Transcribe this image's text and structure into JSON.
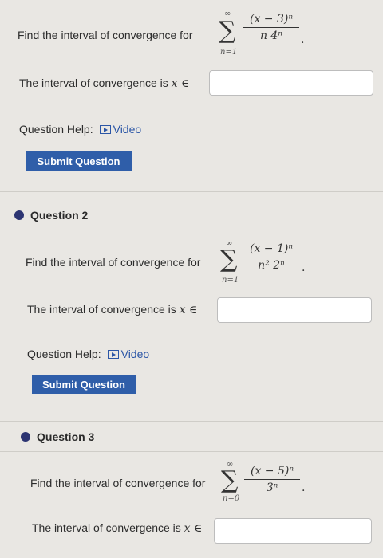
{
  "question1": {
    "prompt": "Find the interval of convergence for",
    "sum_top": "∞",
    "sum_bottom": "n=1",
    "numerator": "(x − 3)ⁿ",
    "denominator": "n 4ⁿ",
    "answer_label_prefix": "The interval of convergence is",
    "answer_var": "x ∈",
    "answer_value": "",
    "help_label": "Question Help:",
    "video_label": "Video",
    "submit_label": "Submit Question"
  },
  "question2": {
    "header": "Question 2",
    "prompt": "Find the interval of convergence for",
    "sum_top": "∞",
    "sum_bottom": "n=1",
    "numerator": "(x − 1)ⁿ",
    "denominator": "n² 2ⁿ",
    "answer_label_prefix": "The interval of convergence is",
    "answer_var": "x ∈",
    "answer_value": "",
    "help_label": "Question Help:",
    "video_label": "Video",
    "submit_label": "Submit Question"
  },
  "question3": {
    "header": "Question 3",
    "prompt": "Find the interval of convergence for",
    "sum_top": "∞",
    "sum_bottom": "n=0",
    "numerator": "(x − 5)ⁿ",
    "denominator": "3ⁿ",
    "answer_label_prefix": "The interval of convergence is",
    "answer_var": "x ∈",
    "answer_value": ""
  },
  "colors": {
    "background": "#e9e7e3",
    "accent": "#2f5ea9",
    "link": "#2b56a6",
    "bullet": "#2c3472"
  }
}
